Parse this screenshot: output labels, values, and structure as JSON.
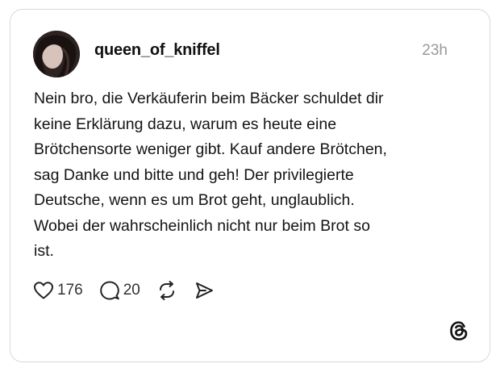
{
  "post": {
    "username": "queen_of_kniffel",
    "time": "23h",
    "text": "Nein bro, die Verkäuferin beim Bäcker schuldet dir\nkeine Erklärung dazu, warum es heute eine\nBrötchensorte weniger gibt. Kauf andere Brötchen,\nsag Danke und bitte und geh! Der privilegierte\nDeutsche, wenn es um Brot geht, unglaublich.\nWobei der wahrscheinlich nicht nur beim Brot so\nist.",
    "likes": "176",
    "comments": "20"
  },
  "icons": {
    "like": "heart-icon",
    "comment": "comment-bubble-icon",
    "repost": "repost-icon",
    "share": "send-icon",
    "brand": "threads-logo-icon"
  }
}
